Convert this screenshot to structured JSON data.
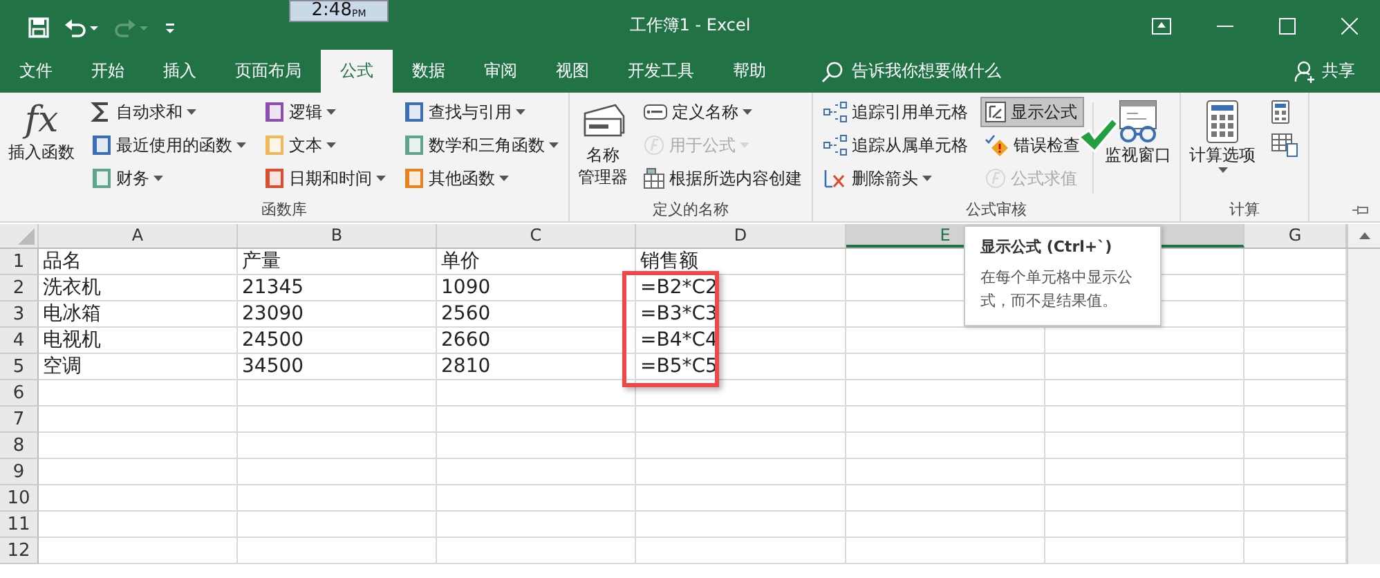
{
  "clock": {
    "time": "2:48",
    "suffix": "PM"
  },
  "window": {
    "title": "工作簿1 - Excel"
  },
  "tabs": [
    {
      "label": "文件",
      "selected": false
    },
    {
      "label": "开始",
      "selected": false
    },
    {
      "label": "插入",
      "selected": false
    },
    {
      "label": "页面布局",
      "selected": false
    },
    {
      "label": "公式",
      "selected": true
    },
    {
      "label": "数据",
      "selected": false
    },
    {
      "label": "审阅",
      "selected": false
    },
    {
      "label": "视图",
      "selected": false
    },
    {
      "label": "开发工具",
      "selected": false
    },
    {
      "label": "帮助",
      "selected": false
    }
  ],
  "tell_me": {
    "placeholder": "告诉我你想要做什么"
  },
  "share": {
    "label": "共享"
  },
  "ribbon": {
    "groups": [
      {
        "label": "函数库",
        "large": [
          {
            "kind": "fx",
            "glyph": "fx",
            "lines": [
              "插入函数"
            ],
            "has_menu": false
          }
        ],
        "columns": [
          [
            {
              "kind": "sigma",
              "label": "自动求和",
              "has_menu": true,
              "disabled": false,
              "pressed": false
            },
            {
              "kind": "book",
              "color": "#3c6eb4",
              "label": "最近使用的函数",
              "has_menu": true,
              "disabled": false,
              "pressed": false
            },
            {
              "kind": "book",
              "color": "#5ea58a",
              "label": "财务",
              "has_menu": true,
              "disabled": false,
              "pressed": false
            }
          ],
          [
            {
              "kind": "book",
              "color": "#8a4fb0",
              "label": "逻辑",
              "has_menu": true,
              "disabled": false,
              "pressed": false
            },
            {
              "kind": "book",
              "color": "#f0b85a",
              "label": "文本",
              "has_menu": true,
              "disabled": false,
              "pressed": false
            },
            {
              "kind": "book",
              "color": "#d9502e",
              "label": "日期和时间",
              "has_menu": true,
              "disabled": false,
              "pressed": false
            }
          ],
          [
            {
              "kind": "book",
              "color": "#3c6eb4",
              "label": "查找与引用",
              "has_menu": true,
              "disabled": false,
              "pressed": false
            },
            {
              "kind": "book",
              "color": "#5ea58a",
              "label": "数学和三角函数",
              "has_menu": true,
              "disabled": false,
              "pressed": false
            },
            {
              "kind": "book",
              "color": "#e8821e",
              "label": "其他函数",
              "has_menu": true,
              "disabled": false,
              "pressed": false
            }
          ]
        ]
      },
      {
        "label": "定义的名称",
        "large": [
          {
            "kind": "names",
            "lines": [
              "名称",
              "管理器"
            ],
            "has_menu": false
          }
        ],
        "columns": [
          [
            {
              "kind": "tag",
              "label": "定义名称",
              "has_menu": true,
              "disabled": false,
              "pressed": false
            },
            {
              "kind": "formula",
              "label": "用于公式",
              "has_menu": true,
              "disabled": true,
              "pressed": false
            },
            {
              "kind": "grid",
              "label": "根据所选内容创建",
              "has_menu": false,
              "disabled": false,
              "pressed": false
            }
          ]
        ]
      },
      {
        "label": "公式审核",
        "large_after": true,
        "large": [
          {
            "kind": "watch",
            "lines": [
              "监视窗口"
            ],
            "has_menu": false
          }
        ],
        "columns": [
          [
            {
              "kind": "trace",
              "label": "追踪引用单元格",
              "has_menu": false,
              "disabled": false,
              "pressed": false
            },
            {
              "kind": "trace",
              "label": "追踪从属单元格",
              "has_menu": false,
              "disabled": false,
              "pressed": false
            },
            {
              "kind": "remove",
              "label": "删除箭头",
              "has_menu": true,
              "disabled": false,
              "pressed": false
            }
          ],
          [
            {
              "kind": "show",
              "label": "显示公式",
              "has_menu": false,
              "disabled": false,
              "pressed": true
            },
            {
              "kind": "error",
              "label": "错误检查",
              "has_menu": false,
              "disabled": false,
              "pressed": false
            },
            {
              "kind": "formula",
              "label": "公式求值",
              "has_menu": false,
              "disabled": true,
              "pressed": false
            }
          ]
        ]
      },
      {
        "label": "计算",
        "large": [
          {
            "kind": "calc",
            "lines": [
              "计算选项"
            ],
            "has_menu": true
          }
        ],
        "columns": [
          [
            {
              "kind": "calc-small",
              "has_menu": false
            },
            {
              "kind": "sheet-calc",
              "has_menu": false
            }
          ]
        ]
      }
    ]
  },
  "sheet": {
    "columns": [
      {
        "label": "A",
        "selected": false
      },
      {
        "label": "B",
        "selected": false
      },
      {
        "label": "C",
        "selected": false
      },
      {
        "label": "D",
        "selected": false
      },
      {
        "label": "E",
        "selected": true
      },
      {
        "selected": true
      },
      {
        "label": "G",
        "selected": false
      }
    ],
    "row_labels": [
      "1",
      "2",
      "3",
      "4",
      "5",
      "6",
      "7",
      "8",
      "9",
      "10",
      "11",
      "12"
    ],
    "rows": [
      [
        "品名",
        "产量",
        "单价",
        "销售额"
      ],
      [
        "洗衣机",
        "21345",
        "1090",
        "=B2*C2"
      ],
      [
        "电冰箱",
        "23090",
        "2560",
        "=B3*C3"
      ],
      [
        "电视机",
        "24500",
        "2660",
        "=B4*C4"
      ],
      [
        "空调",
        "34500",
        "2810",
        "=B5*C5"
      ]
    ]
  },
  "tooltip": {
    "title": "显示公式 (Ctrl+`)",
    "text": "在每个单元格中显示公式，而不是结果值。"
  }
}
